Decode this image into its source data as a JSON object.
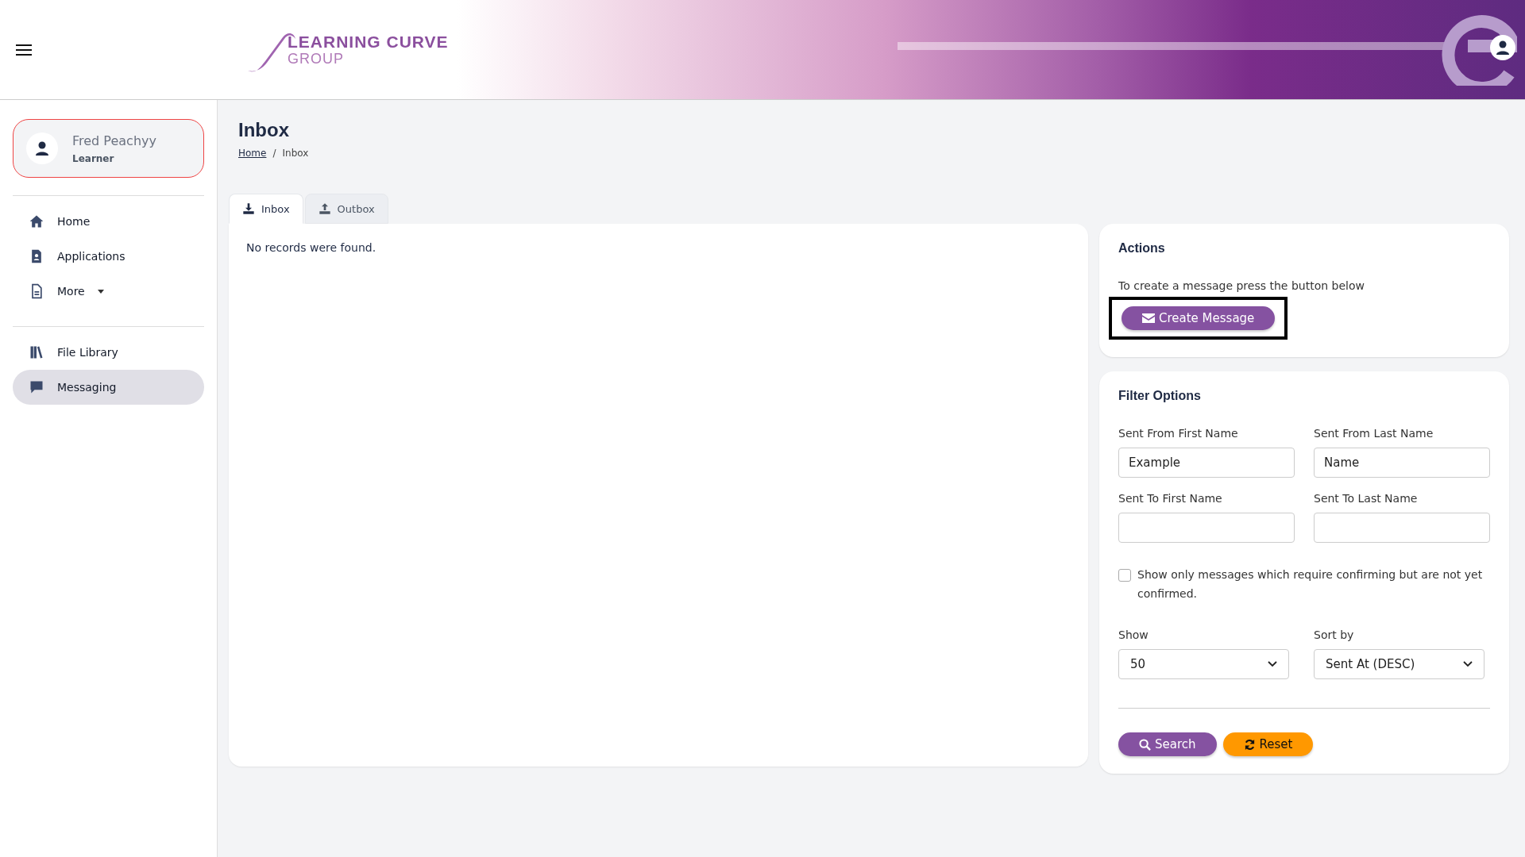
{
  "header": {
    "logo": {
      "line1": "LEARNING CURVE",
      "line2": "GROUP"
    }
  },
  "user": {
    "name": "Fred Peachyy",
    "role": "Learner"
  },
  "sidebar": {
    "groups": [
      [
        {
          "label": "Home",
          "selected": false
        },
        {
          "label": "Applications",
          "selected": false
        },
        {
          "label": "More",
          "selected": false
        }
      ],
      [
        {
          "label": "File Library",
          "selected": false
        },
        {
          "label": "Messaging",
          "selected": true
        }
      ]
    ]
  },
  "page": {
    "title": "Inbox",
    "breadcrumb": [
      "Home",
      "Inbox"
    ],
    "breadcrumb_separator": "/"
  },
  "tabs": [
    {
      "label": "Inbox",
      "selected": true
    },
    {
      "label": "Outbox",
      "selected": false
    }
  ],
  "empty_message": "No records were found.",
  "actions": {
    "title": "Actions",
    "text": "To create a message press the button below",
    "button": "Create Message",
    "highlighted": true
  },
  "filter": {
    "title": "Filter Options",
    "fields": [
      {
        "label": "Sent From First Name",
        "value": "Example"
      },
      {
        "label": "Sent From Last Name",
        "value": "Name"
      },
      {
        "label": "Sent To First Name"
      },
      {
        "label": "Sent To Last Name"
      }
    ],
    "checkbox": {
      "label": "Show only messages which require confirming but are not yet confirmed.",
      "checked": false
    },
    "selects": [
      {
        "label": "Show",
        "value": "50"
      },
      {
        "label": "Sort by",
        "value": "Sent At (DESC)"
      }
    ],
    "buttons": [
      {
        "label": "Search",
        "kind": "search"
      },
      {
        "label": "Reset",
        "kind": "reset"
      }
    ]
  }
}
